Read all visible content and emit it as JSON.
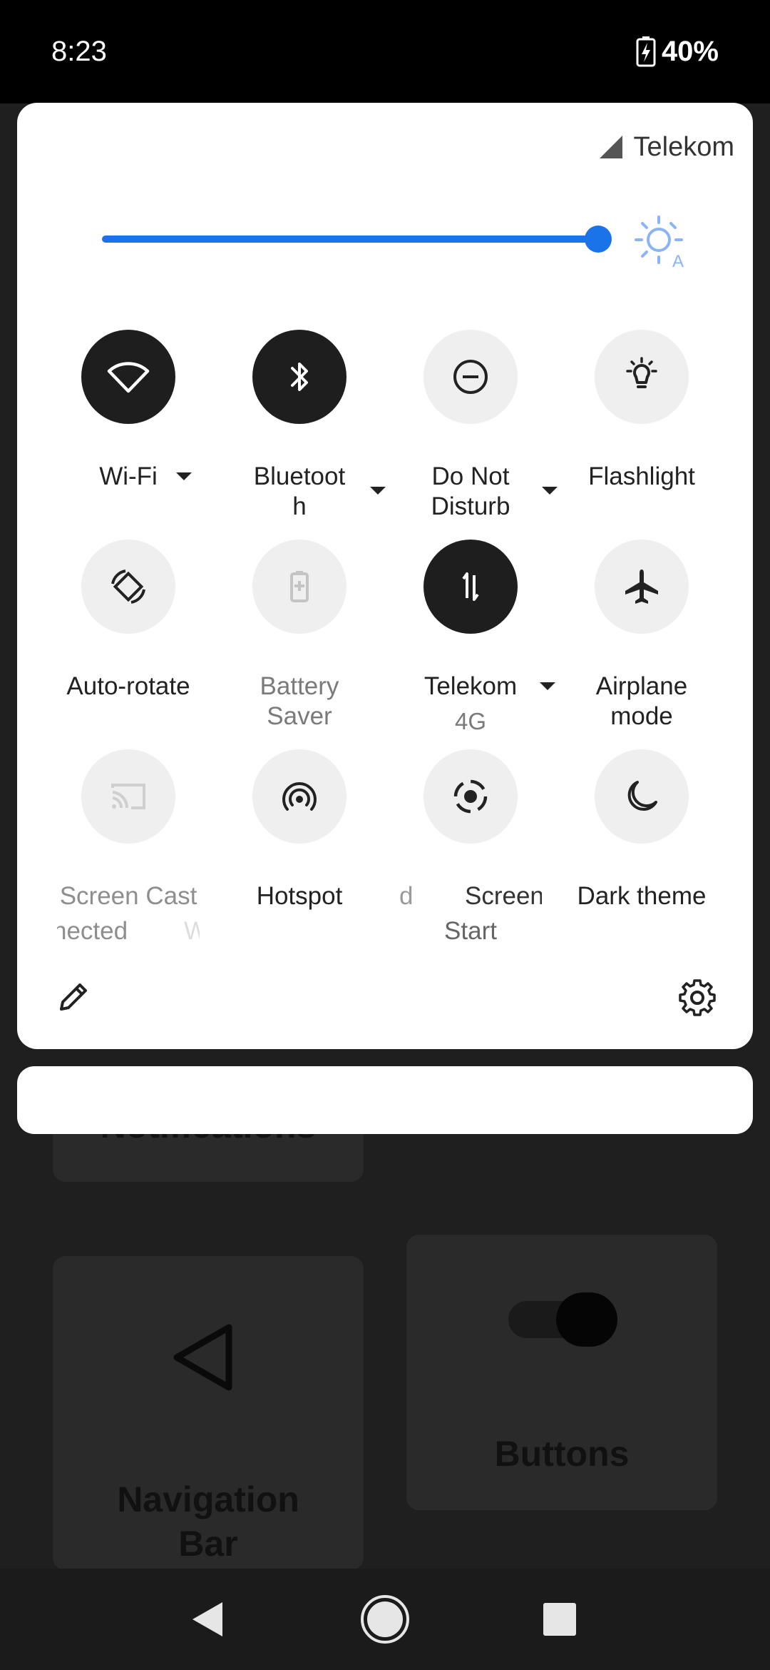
{
  "status_bar": {
    "time": "8:23",
    "battery": "40%"
  },
  "qs": {
    "carrier": "Telekom",
    "brightness_level": 0.97,
    "tiles": [
      {
        "label": "Wi-Fi",
        "state": "on",
        "icon": "wifi-icon"
      },
      {
        "label": "Bluetoot",
        "label2": "h",
        "state": "on",
        "icon": "bluetooth-icon"
      },
      {
        "label": "Do Not",
        "label2": "Disturb",
        "state": "off",
        "icon": "do-not-disturb-icon"
      },
      {
        "label": "Flashlight",
        "state": "off",
        "icon": "flashlight-icon"
      },
      {
        "label": "Auto-rotate",
        "state": "off",
        "icon": "auto-rotate-icon"
      },
      {
        "label": "Battery",
        "label2": "Saver",
        "state": "unavailable",
        "icon": "battery-saver-icon"
      },
      {
        "label": "Telekom",
        "sub": "4G",
        "state": "on",
        "icon": "mobile-data-icon"
      },
      {
        "label": "Airplane",
        "label2": "mode",
        "state": "off",
        "icon": "airplane-icon"
      },
      {
        "label": "Screen Cast",
        "sub_left": "nected",
        "sub_right": "W",
        "state": "unavailable",
        "icon": "cast-icon"
      },
      {
        "label": "Hotspot",
        "state": "off",
        "icon": "hotspot-icon"
      },
      {
        "label_left": "d",
        "label": "Screen",
        "sub": "Start",
        "state": "off",
        "icon": "screen-record-icon"
      },
      {
        "label": "Dark theme",
        "state": "off",
        "icon": "dark-theme-icon"
      }
    ]
  },
  "background": {
    "card_notifications": "Notifications",
    "card_navigation_bar_1": "Navigation",
    "card_navigation_bar_2": "Bar",
    "card_buttons": "Buttons"
  }
}
